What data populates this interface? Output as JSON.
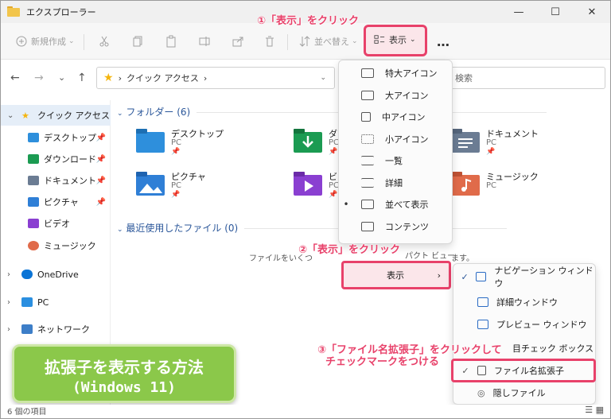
{
  "window": {
    "title": "エクスプローラー",
    "minimize": "—",
    "maximize": "☐",
    "close": "✕"
  },
  "toolbar": {
    "new_label": "新規作成",
    "sort_label": "並べ替え",
    "view_label": "表示",
    "more_label": "…"
  },
  "nav": {
    "back": "←",
    "forward": "→",
    "recent": "⌄",
    "up": "↑"
  },
  "address": {
    "path": "クイック アクセス",
    "chevron": "›",
    "search_placeholder": "検索"
  },
  "sidebar": {
    "items": [
      {
        "label": "クイック アクセス",
        "pin": "",
        "color": "#f5b50e"
      },
      {
        "label": "デスクトップ",
        "pin": "📌",
        "color": "#2e8fdc"
      },
      {
        "label": "ダウンロード",
        "pin": "📌",
        "color": "#1b9b52"
      },
      {
        "label": "ドキュメント",
        "pin": "📌",
        "color": "#6b7c93"
      },
      {
        "label": "ピクチャ",
        "pin": "📌",
        "color": "#2f7fd6"
      },
      {
        "label": "ビデオ",
        "pin": "",
        "color": "#8a3fd1"
      },
      {
        "label": "ミュージック",
        "pin": "",
        "color": "#e06b4a"
      },
      {
        "label": "OneDrive",
        "pin": "",
        "color": "#0a74d6"
      },
      {
        "label": "PC",
        "pin": "",
        "color": "#2b8fe0"
      },
      {
        "label": "ネットワーク",
        "pin": "",
        "color": "#3d7ec8"
      }
    ]
  },
  "content": {
    "folders_header": "フォルダー (6)",
    "recent_header": "最近使用したファイル (0)",
    "empty_message": "ファイルをいくつ",
    "empty_message_tail": "ます。",
    "folders": [
      {
        "name": "デスクトップ",
        "loc": "PC",
        "color": "#2e8fdc"
      },
      {
        "name": "ダ",
        "loc": "PC",
        "color": "#1b9b52"
      },
      {
        "name": "ドキュメント",
        "loc": "PC",
        "color": "#6b7c93"
      },
      {
        "name": "ピクチャ",
        "loc": "PC",
        "color": "#2f7fd6"
      },
      {
        "name": "ビ",
        "loc": "PC",
        "color": "#8a3fd1"
      },
      {
        "name": "ミュージック",
        "loc": "PC",
        "color": "#e06b4a"
      }
    ]
  },
  "view_menu": {
    "items": [
      {
        "label": "特大アイコン",
        "bullet": ""
      },
      {
        "label": "大アイコン",
        "bullet": ""
      },
      {
        "label": "中アイコン",
        "bullet": ""
      },
      {
        "label": "小アイコン",
        "bullet": ""
      },
      {
        "label": "一覧",
        "bullet": ""
      },
      {
        "label": "詳細",
        "bullet": ""
      },
      {
        "label": "並べて表示",
        "bullet": "•"
      },
      {
        "label": "コンテンツ",
        "bullet": ""
      }
    ],
    "compact_tail": "パクト ビュー",
    "show_label": "表示",
    "show_arrow": "›"
  },
  "show_submenu": {
    "items": [
      {
        "label": "ナビゲーション ウィンドウ",
        "check": "✓"
      },
      {
        "label": "詳細ウィンドウ",
        "check": ""
      },
      {
        "label": "プレビュー ウィンドウ",
        "check": ""
      },
      {
        "label": "目チェック ボックス",
        "check": ""
      },
      {
        "label": "ファイル名拡張子",
        "check": "✓"
      },
      {
        "label": "隠しファイル",
        "check": ""
      }
    ]
  },
  "callouts": {
    "step1": "①「表示」をクリック",
    "step2": "②「表示」をクリック",
    "step3_line1": "③「ファイル名拡張子」をクリックして",
    "step3_line2": "チェックマークをつける"
  },
  "banner": {
    "line1": "拡張子を表示する方法",
    "line2": "(Windows 11)"
  },
  "status": {
    "count": "6 個の項目",
    "view_icons": "☰ ▦"
  }
}
